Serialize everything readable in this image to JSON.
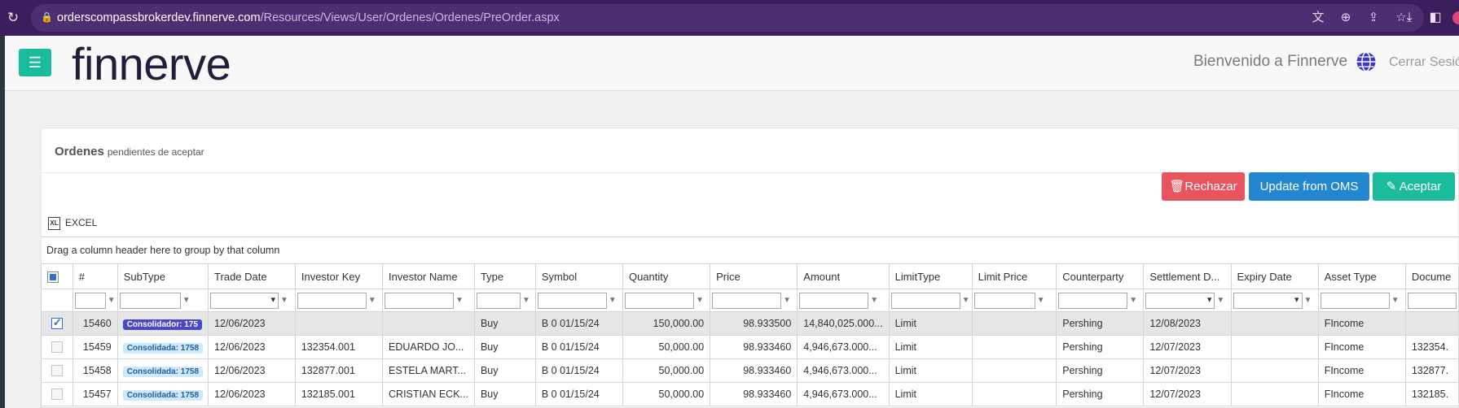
{
  "browser": {
    "url_host": "orderscompassbrokerdev.finnerve.com",
    "url_path": "/Resources/Views/User/Ordenes/Ordenes/PreOrder.aspx",
    "accent": "#3b1f5c"
  },
  "header": {
    "logo": "finnerve",
    "welcome": "Bienvenido a Finnerve",
    "logout": "Cerrar Sesió",
    "brand_color": "#1abc9c"
  },
  "panel": {
    "title": "Ordenes",
    "subtitle": "pendientes de aceptar"
  },
  "actions": {
    "reject": "Rechazar",
    "update": "Update from OMS",
    "accept": "Aceptar"
  },
  "toolbar": {
    "excel": "EXCEL",
    "group_hint": "Drag a column header here to group by that column"
  },
  "grid": {
    "columns": [
      "#",
      "SubType",
      "Trade Date",
      "Investor Key",
      "Investor Name",
      "Type",
      "Symbol",
      "Quantity",
      "Price",
      "Amount",
      "LimitType",
      "Limit Price",
      "Counterparty",
      "Settlement D...",
      "Expiry Date",
      "Asset Type",
      "Docume"
    ],
    "rows": [
      {
        "selected": true,
        "num": "15460",
        "subtype": "Consolidador: 175",
        "subtype_style": "dark",
        "trade_date": "12/06/2023",
        "investor_key": "",
        "investor_name": "",
        "type": "Buy",
        "symbol": "B 0 01/15/24",
        "quantity": "150,000.00",
        "price": "98.933500",
        "amount": "14,840,025.000...",
        "limit_type": "Limit",
        "limit_price": "",
        "counterparty": "Pershing",
        "settlement": "12/08/2023",
        "expiry": "",
        "asset_type": "FIncome",
        "document": ""
      },
      {
        "selected": false,
        "num": "15459",
        "subtype": "Consolidada: 1758",
        "subtype_style": "light",
        "trade_date": "12/06/2023",
        "investor_key": "132354.001",
        "investor_name": "EDUARDO JO...",
        "type": "Buy",
        "symbol": "B 0 01/15/24",
        "quantity": "50,000.00",
        "price": "98.933460",
        "amount": "4,946,673.000...",
        "limit_type": "Limit",
        "limit_price": "",
        "counterparty": "Pershing",
        "settlement": "12/07/2023",
        "expiry": "",
        "asset_type": "FIncome",
        "document": "132354."
      },
      {
        "selected": false,
        "num": "15458",
        "subtype": "Consolidada: 1758",
        "subtype_style": "light",
        "trade_date": "12/06/2023",
        "investor_key": "132877.001",
        "investor_name": "ESTELA MART...",
        "type": "Buy",
        "symbol": "B 0 01/15/24",
        "quantity": "50,000.00",
        "price": "98.933460",
        "amount": "4,946,673.000...",
        "limit_type": "Limit",
        "limit_price": "",
        "counterparty": "Pershing",
        "settlement": "12/07/2023",
        "expiry": "",
        "asset_type": "FIncome",
        "document": "132877."
      },
      {
        "selected": false,
        "num": "15457",
        "subtype": "Consolidada: 1758",
        "subtype_style": "light",
        "trade_date": "12/06/2023",
        "investor_key": "132185.001",
        "investor_name": "CRISTIAN ECK...",
        "type": "Buy",
        "symbol": "B 0 01/15/24",
        "quantity": "50,000.00",
        "price": "98.933460",
        "amount": "4,946,673.000...",
        "limit_type": "Limit",
        "limit_price": "",
        "counterparty": "Pershing",
        "settlement": "12/07/2023",
        "expiry": "",
        "asset_type": "FIncome",
        "document": "132185."
      }
    ]
  }
}
